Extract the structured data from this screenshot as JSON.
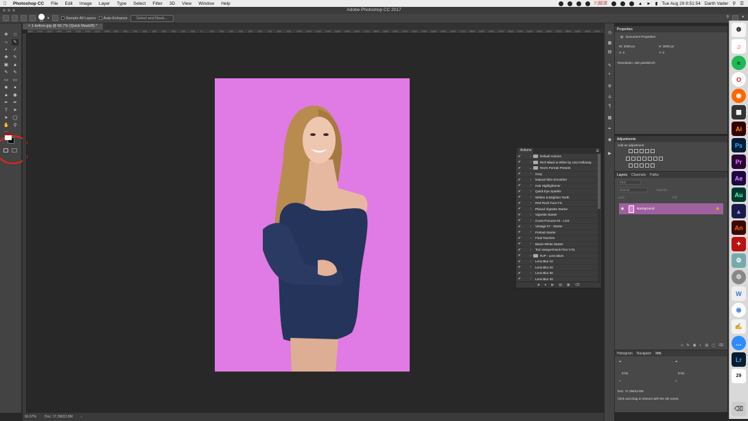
{
  "menubar": {
    "app": "Photoshop CC",
    "items": [
      "File",
      "Edit",
      "Image",
      "Layer",
      "Type",
      "Select",
      "Filter",
      "3D",
      "View",
      "Window",
      "Help"
    ],
    "memory_line1": "U: 2632 MB",
    "memory_line2": "F: 1885 MB",
    "datetime": "Tue Aug 29  8:51:54",
    "user": "Darth Vader"
  },
  "window": {
    "title": "Adobe Photoshop CC 2017"
  },
  "options": {
    "brush_size": "700",
    "sample_all_layers": "Sample All Layers",
    "auto_enhance": "Auto-Enhance",
    "select_and_mask": "Select and Mask..."
  },
  "document": {
    "tab": "1-before.jpg @ 66.7% (Quick Mask/8) *",
    "zoom": "66.67%",
    "doc_size": "Doc: 17.2M/22.8M",
    "ruler_ticks": [
      "1800",
      "1700",
      "1600",
      "1500",
      "1400",
      "1300",
      "1200",
      "1100",
      "1000",
      "900",
      "800",
      "700",
      "600",
      "500",
      "400",
      "300",
      "200",
      "100",
      "0",
      "100",
      "200",
      "300",
      "400",
      "500",
      "600",
      "700",
      "800",
      "900",
      "1000",
      "1100",
      "1200",
      "1300",
      "1400",
      "1500",
      "1600",
      "1700",
      "1800",
      "1900",
      "2000",
      "2100",
      "2200",
      "2300",
      "2400",
      "2500",
      "2600",
      "2700",
      "2800",
      "2900",
      "3000",
      "3100",
      "3200",
      "3300",
      "3400",
      "3500",
      "3600",
      "3700",
      "3800",
      "3900",
      "4000",
      "4100"
    ]
  },
  "actions": {
    "title": "Actions",
    "rows": [
      {
        "label": "Default Actions",
        "type": "set"
      },
      {
        "label": "Rich Black & White by Lisa Holloway",
        "type": "set"
      },
      {
        "label": "Rev's Portrait Presets",
        "type": "set-open"
      },
      {
        "label": "Grey",
        "type": "item"
      },
      {
        "label": "Natural Skin Smoother",
        "type": "item"
      },
      {
        "label": "Hair Highlightener",
        "type": "item"
      },
      {
        "label": "Quick Eye Sparkle",
        "type": "item"
      },
      {
        "label": "Whiten & Brighten Teeth",
        "type": "item"
      },
      {
        "label": "Red Rock Face Fix",
        "type": "item"
      },
      {
        "label": "Placed Vignette Starter",
        "type": "item"
      },
      {
        "label": "Vignette Starter",
        "type": "item"
      },
      {
        "label": "Cross Process #2 - LGS",
        "type": "item"
      },
      {
        "label": "Vintage #7 - Starter",
        "type": "item"
      },
      {
        "label": "Portrait Starter",
        "type": "item"
      },
      {
        "label": "Final Touches",
        "type": "item"
      },
      {
        "label": "Black+White Starter",
        "type": "item"
      },
      {
        "label": "Tom Sawyer/Huck Finn V-01",
        "type": "item"
      },
      {
        "label": "RJP - Lens Blurs",
        "type": "set-open"
      },
      {
        "label": "Lens Blur 10",
        "type": "item"
      },
      {
        "label": "Lens Blur 20",
        "type": "item"
      },
      {
        "label": "Lens Blur 30",
        "type": "item"
      },
      {
        "label": "Lens Blur 40",
        "type": "item"
      }
    ]
  },
  "properties": {
    "title": "Properties",
    "subtitle": "Document Properties",
    "w": "W:  2000 px",
    "h": "H:  3000 px",
    "x": "X:  0",
    "y": "Y:  0",
    "resolution": "Resolution: 150 pixels/inch"
  },
  "adjustments": {
    "title": "Adjustments",
    "subtitle": "Add an adjustment"
  },
  "layers": {
    "tabs": [
      "Layers",
      "Channels",
      "Paths"
    ],
    "kind": "Kind",
    "blend": "Normal",
    "opacity": "Opacity:",
    "lock": "Lock:",
    "fill": "Fill:",
    "layer_name": "Background"
  },
  "info": {
    "tabs": [
      "Histogram",
      "Navigator",
      "Info"
    ],
    "bit1": "8-bit",
    "bit2": "8-bit",
    "doc": "Doc: 17.2M/22.8M",
    "hint": "Click and drag to interact with the 3D scene."
  },
  "dock": {
    "apps": [
      "Ai",
      "Ps",
      "Pr",
      "Ae",
      "Au",
      "An",
      "Lr"
    ],
    "calendar_day": "29"
  },
  "colors": {
    "photo_bg": "#e07ae4",
    "quick_mask_layer": "#9e619f",
    "annotation_circle": "#e21111"
  }
}
